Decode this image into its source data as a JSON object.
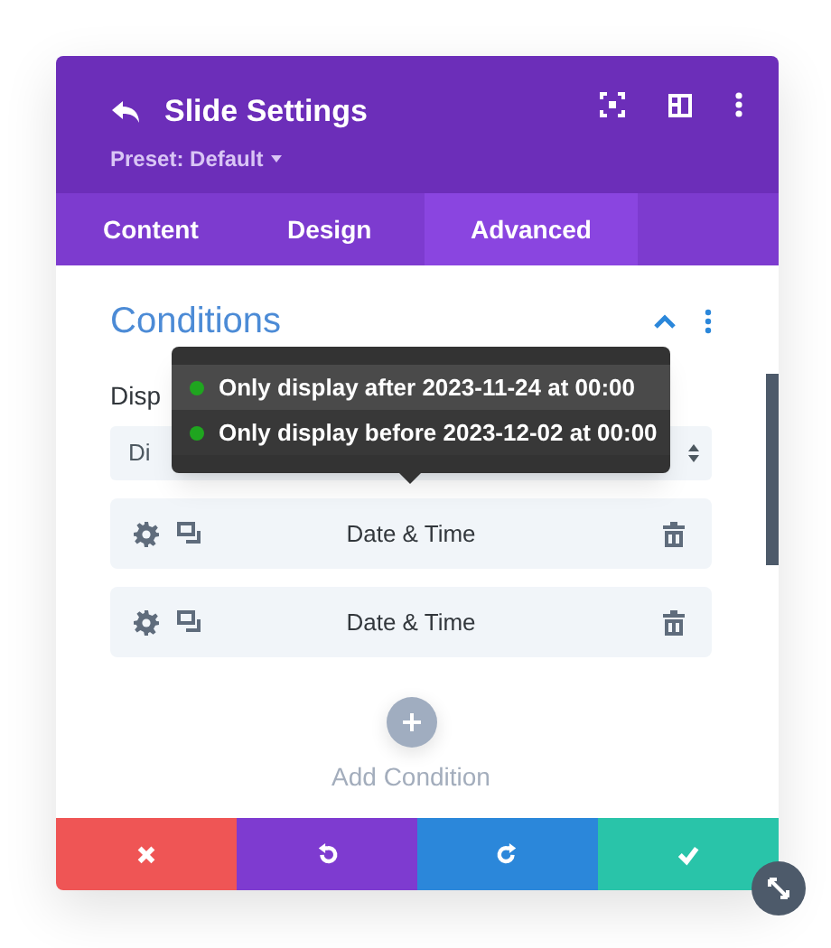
{
  "header": {
    "title": "Slide Settings",
    "preset": "Preset: Default"
  },
  "tabs": [
    {
      "label": "Content",
      "selected": false
    },
    {
      "label": "Design",
      "selected": false
    },
    {
      "label": "Advanced",
      "selected": true
    }
  ],
  "section": {
    "title": "Conditions",
    "expanded": true
  },
  "field": {
    "label": "Disp",
    "value": "Di"
  },
  "tooltip": {
    "items": [
      {
        "text": "Only display after 2023-11-24 at 00:00",
        "color": "#1fa51f",
        "selected": true
      },
      {
        "text": "Only display before 2023-12-02 at 00:00",
        "color": "#1fa51f",
        "selected": false
      }
    ]
  },
  "conditions": [
    {
      "label": "Date & Time"
    },
    {
      "label": "Date & Time"
    }
  ],
  "add_button": {
    "label": "Add Condition"
  },
  "footer": [
    {
      "kind": "cancel"
    },
    {
      "kind": "undo"
    },
    {
      "kind": "redo"
    },
    {
      "kind": "save"
    }
  ]
}
